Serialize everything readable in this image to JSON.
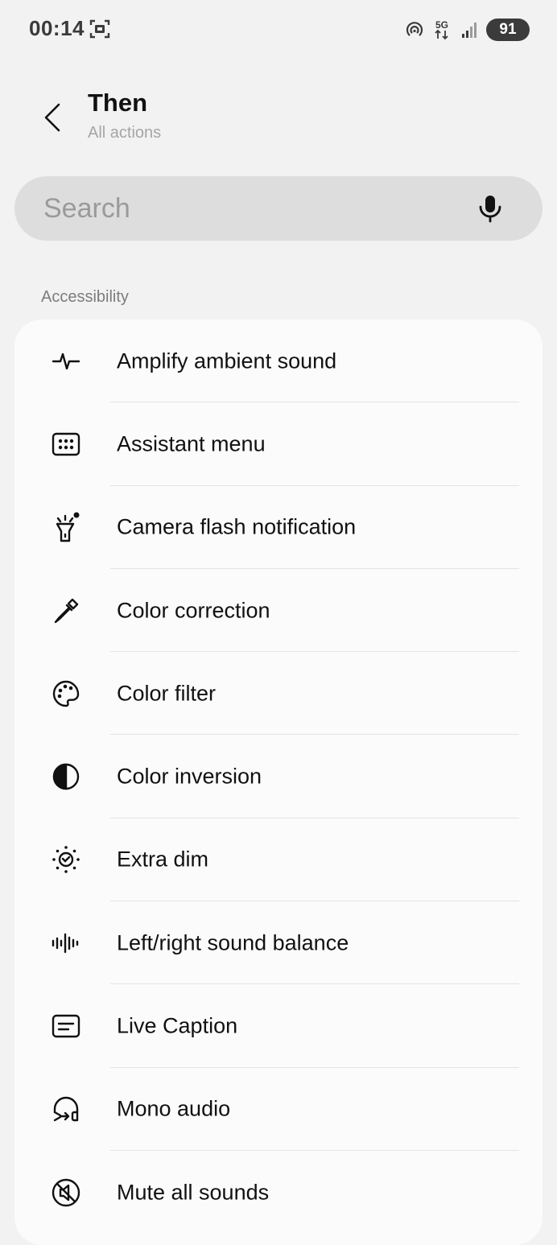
{
  "status_bar": {
    "time": "00:14",
    "network": "5G",
    "battery": "91",
    "icons": [
      "screenshot-icon",
      "hotspot-icon",
      "5g-data-icon",
      "signal-icon"
    ]
  },
  "header": {
    "title": "Then",
    "subtitle": "All actions",
    "back_icon": "back-chevron-icon"
  },
  "search": {
    "placeholder": "Search",
    "value": "",
    "mic_icon": "microphone-icon"
  },
  "section": {
    "label": "Accessibility"
  },
  "items": [
    {
      "label": "Amplify ambient sound",
      "icon": "waveform-icon"
    },
    {
      "label": "Assistant menu",
      "icon": "grid-menu-icon"
    },
    {
      "label": "Camera flash notification",
      "icon": "flashlight-icon"
    },
    {
      "label": "Color correction",
      "icon": "eyedropper-icon"
    },
    {
      "label": "Color filter",
      "icon": "palette-icon"
    },
    {
      "label": "Color inversion",
      "icon": "contrast-icon"
    },
    {
      "label": "Extra dim",
      "icon": "dim-sun-icon"
    },
    {
      "label": "Left/right sound balance",
      "icon": "sound-bars-icon"
    },
    {
      "label": "Live Caption",
      "icon": "caption-icon"
    },
    {
      "label": "Mono audio",
      "icon": "headphone-mono-icon"
    },
    {
      "label": "Mute all sounds",
      "icon": "mute-icon"
    }
  ]
}
